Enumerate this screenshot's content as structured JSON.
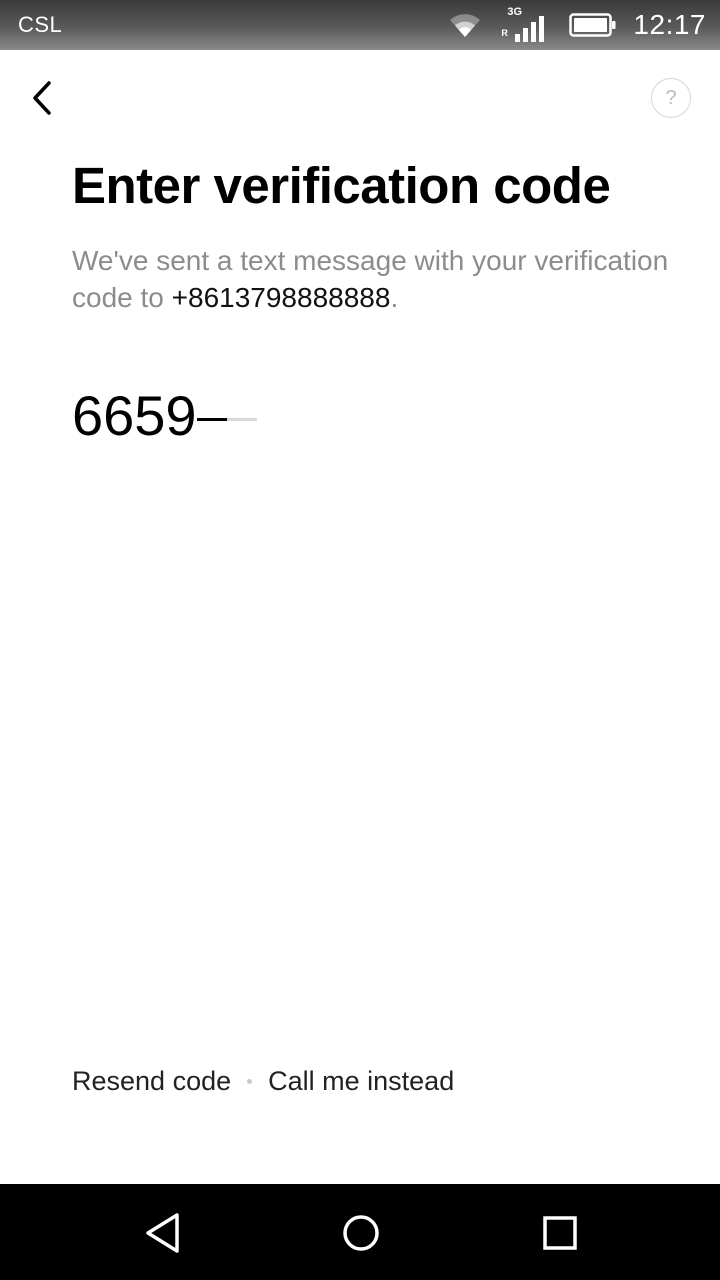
{
  "status_bar": {
    "carrier": "CSL",
    "network_type": "3G",
    "roaming": "R",
    "time": "12:17",
    "icons": [
      "wifi-icon",
      "signal-icon",
      "battery-icon"
    ]
  },
  "toolbar": {
    "back_icon": "chevron-left-icon",
    "help_label": "?"
  },
  "title": "Enter verification code",
  "description": {
    "text": "We've sent a text message with your verification code to ",
    "phone": "+8613798888888",
    "suffix": "."
  },
  "code_input": {
    "value": "6659"
  },
  "actions": {
    "resend_label": "Resend code",
    "call_label": "Call me instead"
  },
  "nav_bar": {
    "icons": [
      "nav-back-icon",
      "nav-home-icon",
      "nav-recents-icon"
    ]
  },
  "colors": {
    "text_primary": "#000000",
    "text_secondary": "#8c8c8c",
    "nav_bar": "#000000"
  }
}
